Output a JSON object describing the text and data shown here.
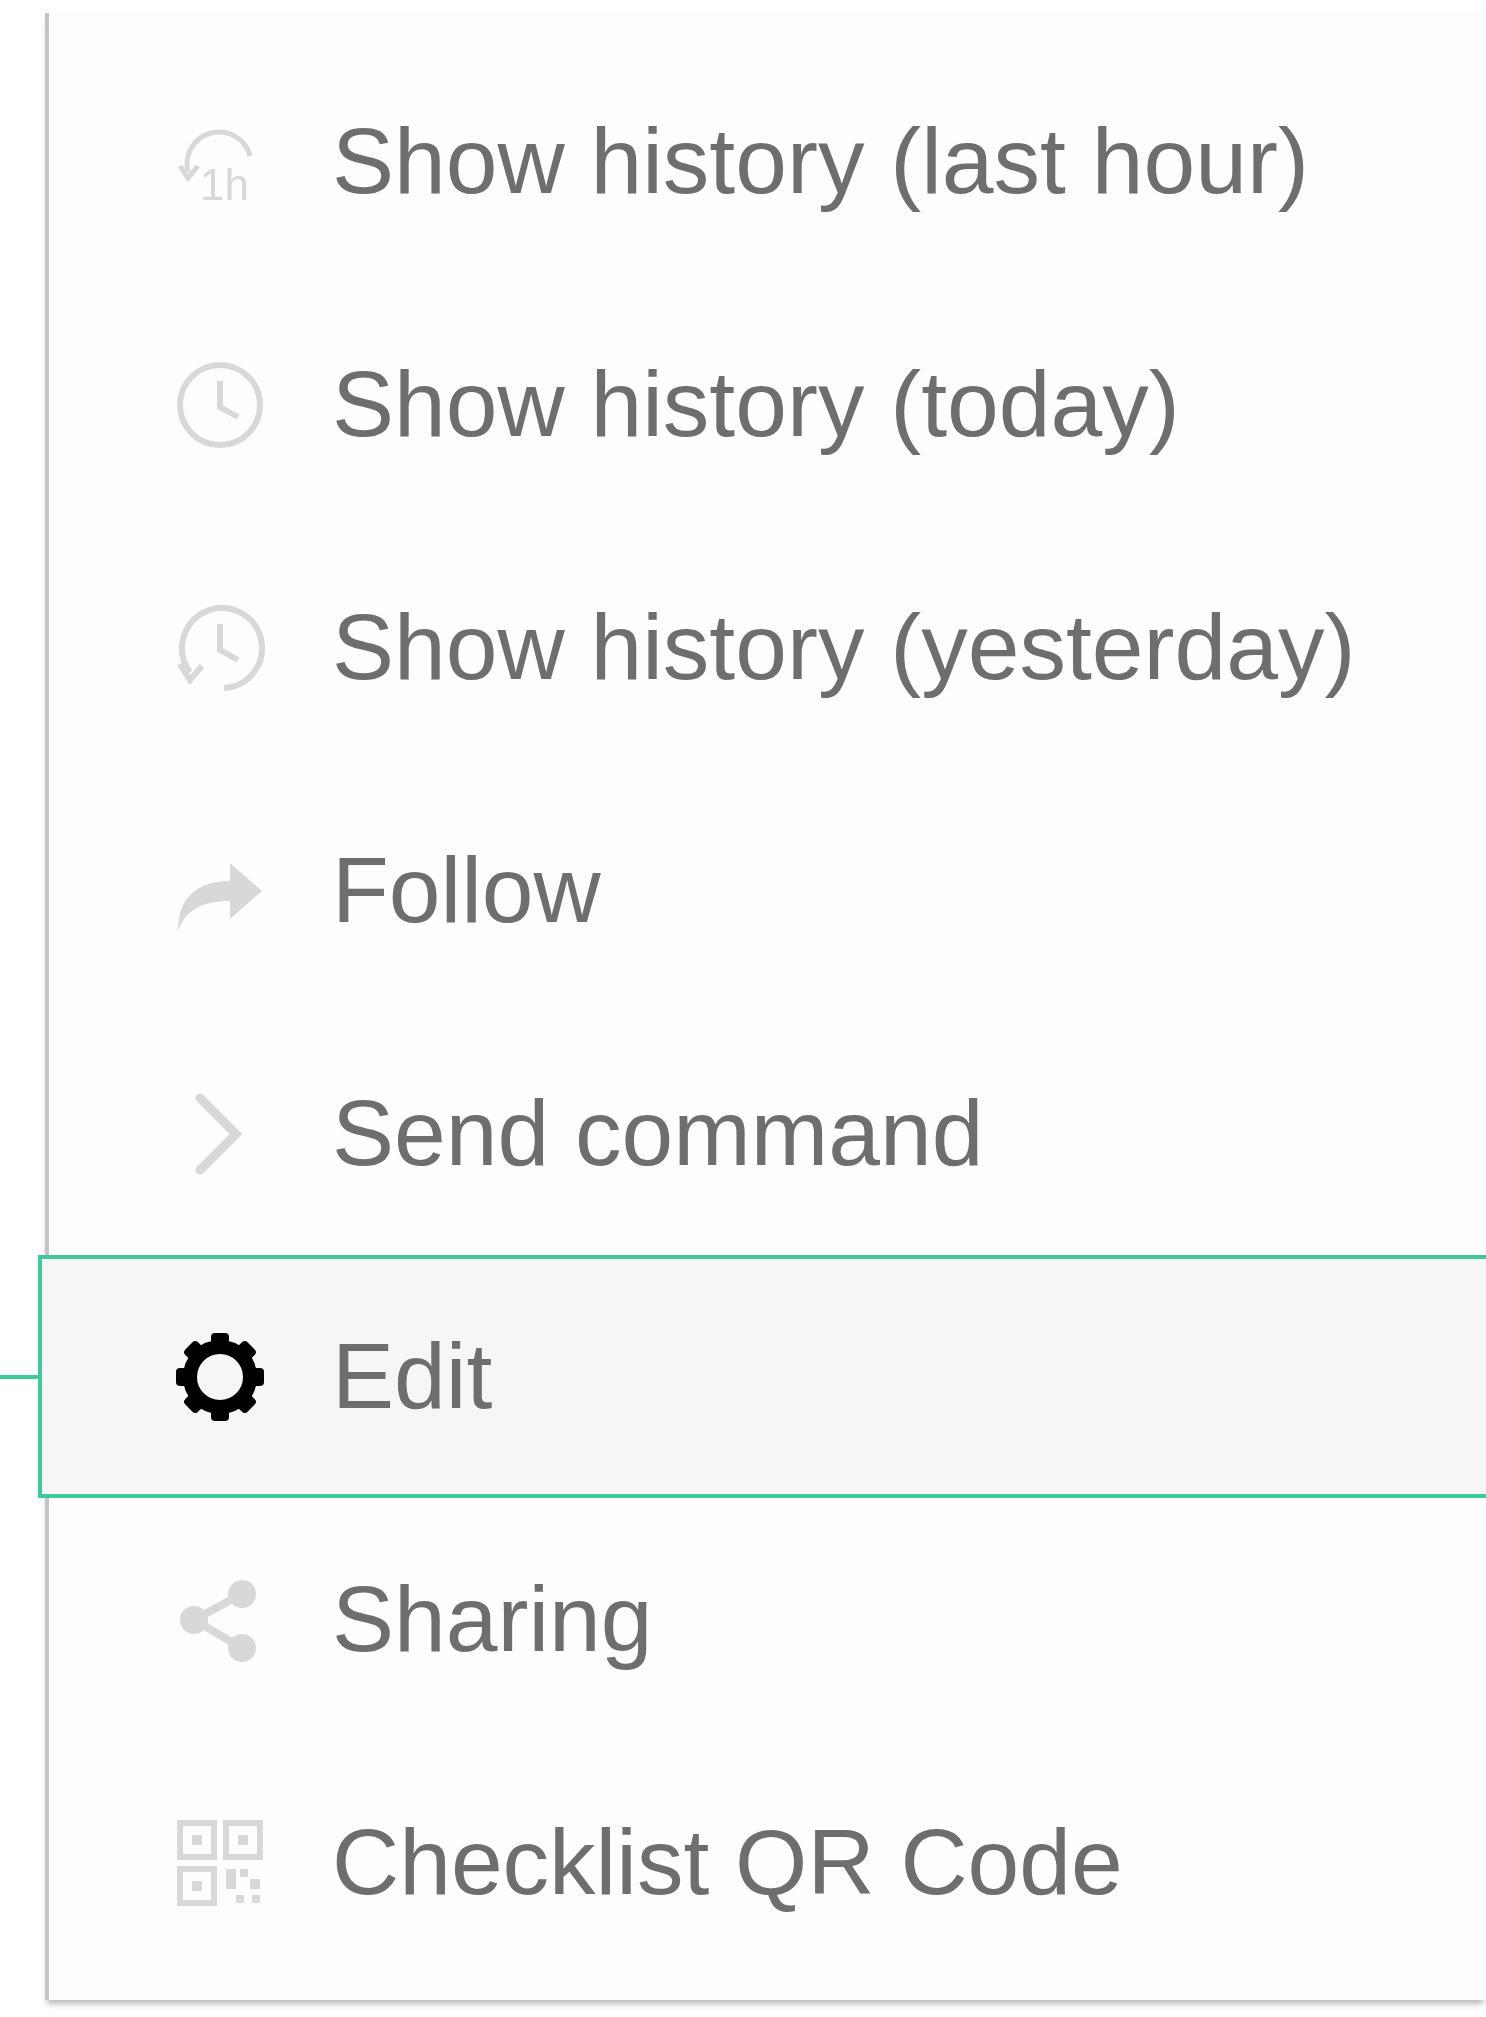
{
  "menu": {
    "items": [
      {
        "label": "Show history (last hour)",
        "icon_label": "1h",
        "selected": false
      },
      {
        "label": "Show history (today)",
        "selected": false
      },
      {
        "label": "Show history (yesterday)",
        "selected": false
      },
      {
        "label": "Follow",
        "selected": false
      },
      {
        "label": "Send command",
        "selected": false
      },
      {
        "label": "Edit",
        "selected": true
      },
      {
        "label": "Sharing",
        "selected": false
      },
      {
        "label": "Checklist QR Code",
        "selected": false
      }
    ]
  }
}
